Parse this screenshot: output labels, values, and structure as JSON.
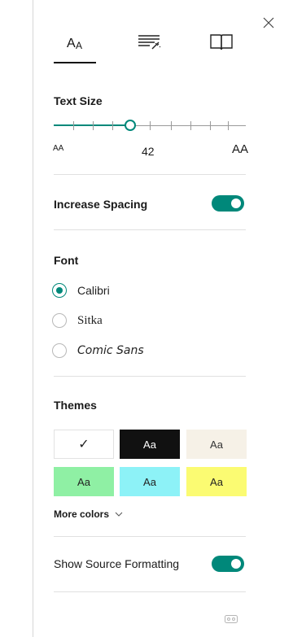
{
  "tabs": [
    {
      "icon": "text-size-icon",
      "label": "Text options"
    },
    {
      "icon": "grammar-tools-icon",
      "label": "Grammar options"
    },
    {
      "icon": "reading-preferences-icon",
      "label": "Reading preferences"
    }
  ],
  "text_size": {
    "title": "Text Size",
    "value_label": "42",
    "value": 42,
    "position_fraction": 0.4,
    "small_glyph": "AA",
    "large_glyph": "AA"
  },
  "spacing": {
    "label": "Increase Spacing",
    "enabled": true
  },
  "font": {
    "title": "Font",
    "options": [
      {
        "label": "Calibri",
        "selected": true
      },
      {
        "label": "Sitka",
        "selected": false
      },
      {
        "label": "Comic Sans",
        "selected": false
      }
    ]
  },
  "themes": {
    "title": "Themes",
    "selected_mark": "✓",
    "swatches": [
      {
        "label": "",
        "bg": "#ffffff",
        "fg": "#222222",
        "selected": true
      },
      {
        "label": "Aa",
        "bg": "#111111",
        "fg": "#ffffff",
        "selected": false
      },
      {
        "label": "Aa",
        "bg": "#f6f1e7",
        "fg": "#333333",
        "selected": false
      },
      {
        "label": "Aa",
        "bg": "#8ff0a4",
        "fg": "#222222",
        "selected": false
      },
      {
        "label": "Aa",
        "bg": "#8df2f7",
        "fg": "#222222",
        "selected": false
      },
      {
        "label": "Aa",
        "bg": "#fbfb72",
        "fg": "#222222",
        "selected": false
      }
    ],
    "more_colors_label": "More colors"
  },
  "source_formatting": {
    "label": "Show Source Formatting",
    "enabled": true
  },
  "colors": {
    "accent": "#00887a",
    "divider": "#e0e0e0"
  }
}
